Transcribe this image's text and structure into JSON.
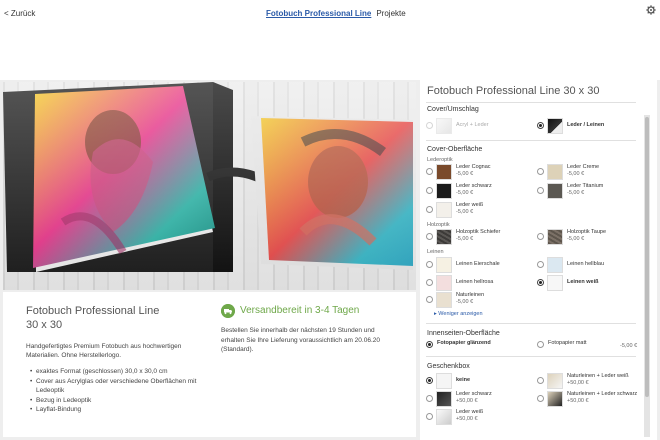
{
  "topbar": {
    "back_label": "< Zurück",
    "tabs": [
      "Fotobuch Professional Line",
      "Projekte"
    ],
    "settings_icon": "gear-icon"
  },
  "product": {
    "title_line1": "Fotobuch Professional Line",
    "title_line2": "30 x 30",
    "description": "Handgefertigtes Premium Fotobuch aus hochwertigen Materialien. Ohne Herstellerlogo.",
    "features": [
      "exaktes Format (geschlossen) 30,0 x 30,0 cm",
      "Cover aus Acrylglas oder verschiedene Oberflächen mit Ledeoptik",
      "Bezug in Ledeoptik",
      "Layflat-Bindung"
    ],
    "shipping_title": "Versandbereit in 3-4 Tagen",
    "shipping_text": "Bestellen Sie innerhalb der nächsten 19 Stunden und erhalten Sie Ihre Lieferung voraussichtlich am 20.06.20 (Standard).",
    "shipping_icon": "truck-icon"
  },
  "config": {
    "title": "Fotobuch Professional Line 30 x 30",
    "cover": {
      "heading": "Cover/Umschlag",
      "options": [
        {
          "label": "Acryl + Leder",
          "selected": false,
          "disabled": true
        },
        {
          "label": "Leder / Leinen",
          "selected": true
        }
      ]
    },
    "surface": {
      "heading": "Cover-Oberfläche",
      "groups": [
        {
          "name": "Lederoptik",
          "items": [
            {
              "label": "Leder Cognac",
              "price": "-5,00 €"
            },
            {
              "label": "Leder Creme",
              "price": "-5,00 €"
            },
            {
              "label": "Leder schwarz",
              "price": "-5,00 €"
            },
            {
              "label": "Leder Titanium",
              "price": "-5,00 €"
            },
            {
              "label": "Leder weiß",
              "price": "-5,00 €"
            }
          ]
        },
        {
          "name": "Holzoptik",
          "items": [
            {
              "label": "Holzoptik Schiefer",
              "price": "-5,00 €"
            },
            {
              "label": "Holzoptik Taupe",
              "price": "-5,00 €"
            }
          ]
        },
        {
          "name": "Leinen",
          "items": [
            {
              "label": "Leinen Eierschale",
              "price": ""
            },
            {
              "label": "Leinen hellblau",
              "price": ""
            },
            {
              "label": "Leinen hellrosa",
              "price": ""
            },
            {
              "label": "Leinen weiß",
              "price": "",
              "selected": true
            },
            {
              "label": "Naturleinen",
              "price": "-5,00 €"
            }
          ]
        }
      ],
      "less_link": "Weniger anzeigen"
    },
    "inner": {
      "heading": "Innenseiten-Oberfläche",
      "options": [
        {
          "label": "Fotopapier glänzend",
          "selected": true
        },
        {
          "label": "Fotopapier matt",
          "price": "-5,00 €"
        }
      ]
    },
    "giftbox": {
      "heading": "Geschenkbox",
      "options": [
        {
          "label": "keine",
          "selected": true
        },
        {
          "label": "Naturleinen + Leder weiß",
          "price": "+50,00 €"
        },
        {
          "label": "Leder schwarz",
          "price": "+50,00 €"
        },
        {
          "label": "Naturleinen + Leder schwarz",
          "price": "+50,00 €"
        },
        {
          "label": "Leder weiß",
          "price": "+50,00 €"
        }
      ]
    }
  }
}
